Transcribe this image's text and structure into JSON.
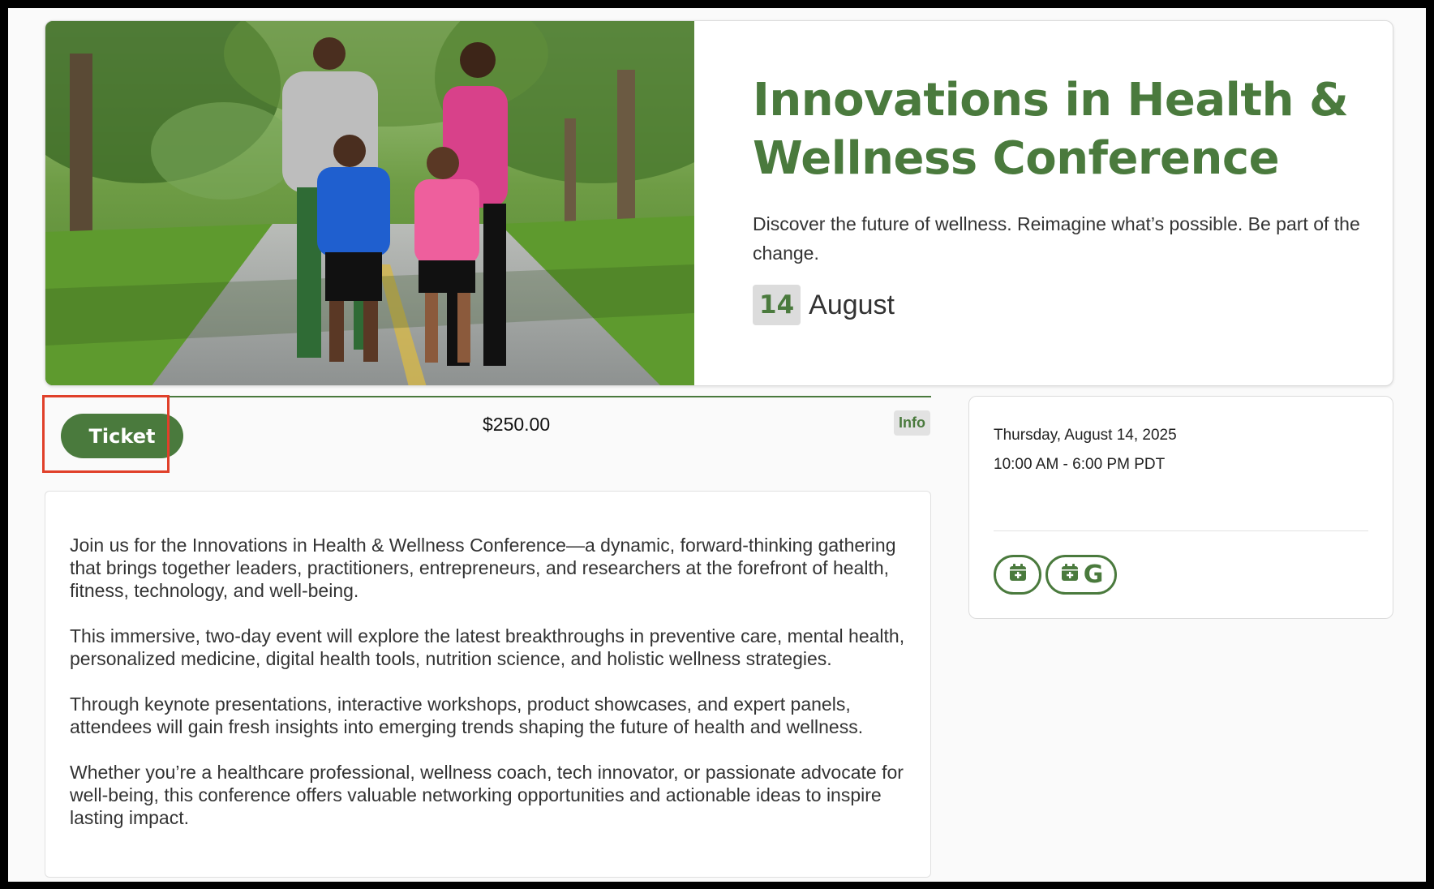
{
  "event": {
    "title": "Innovations in Health & Wellness Conference",
    "subtitle": "Discover the future of wellness. Reimagine what’s possible. Be part of the change.",
    "date_day": "14",
    "date_month": "August"
  },
  "ticket": {
    "button_label": "Ticket",
    "price": "$250.00",
    "info_label": "Info"
  },
  "description": {
    "paragraphs": [
      "Join us for the Innovations in Health & Wellness Conference—a dynamic, forward-thinking gathering that brings together leaders, practitioners, entrepreneurs, and researchers at the forefront of health, fitness, technology, and well-being.",
      "This immersive, two-day event will explore the latest breakthroughs in preventive care, mental health, personalized medicine, digital health tools, nutrition science, and holistic wellness strategies.",
      "Through keynote presentations, interactive workshops, product showcases, and expert panels, attendees will gain fresh insights into emerging trends shaping the future of health and wellness.",
      "Whether you’re a healthcare professional, wellness coach, tech innovator, or passionate advocate for well-being, this conference offers valuable networking opportunities and actionable ideas to inspire lasting impact."
    ]
  },
  "schedule": {
    "date": "Thursday, August 14, 2025",
    "time": "10:00 AM - 6:00 PM PDT",
    "calendar_buttons": [
      {
        "icon": "calendar-add-icon"
      },
      {
        "icon": "google-calendar-add-icon",
        "letter": "G"
      }
    ]
  },
  "colors": {
    "brand_green": "#4a7a3d",
    "highlight_red": "#e0402a"
  }
}
